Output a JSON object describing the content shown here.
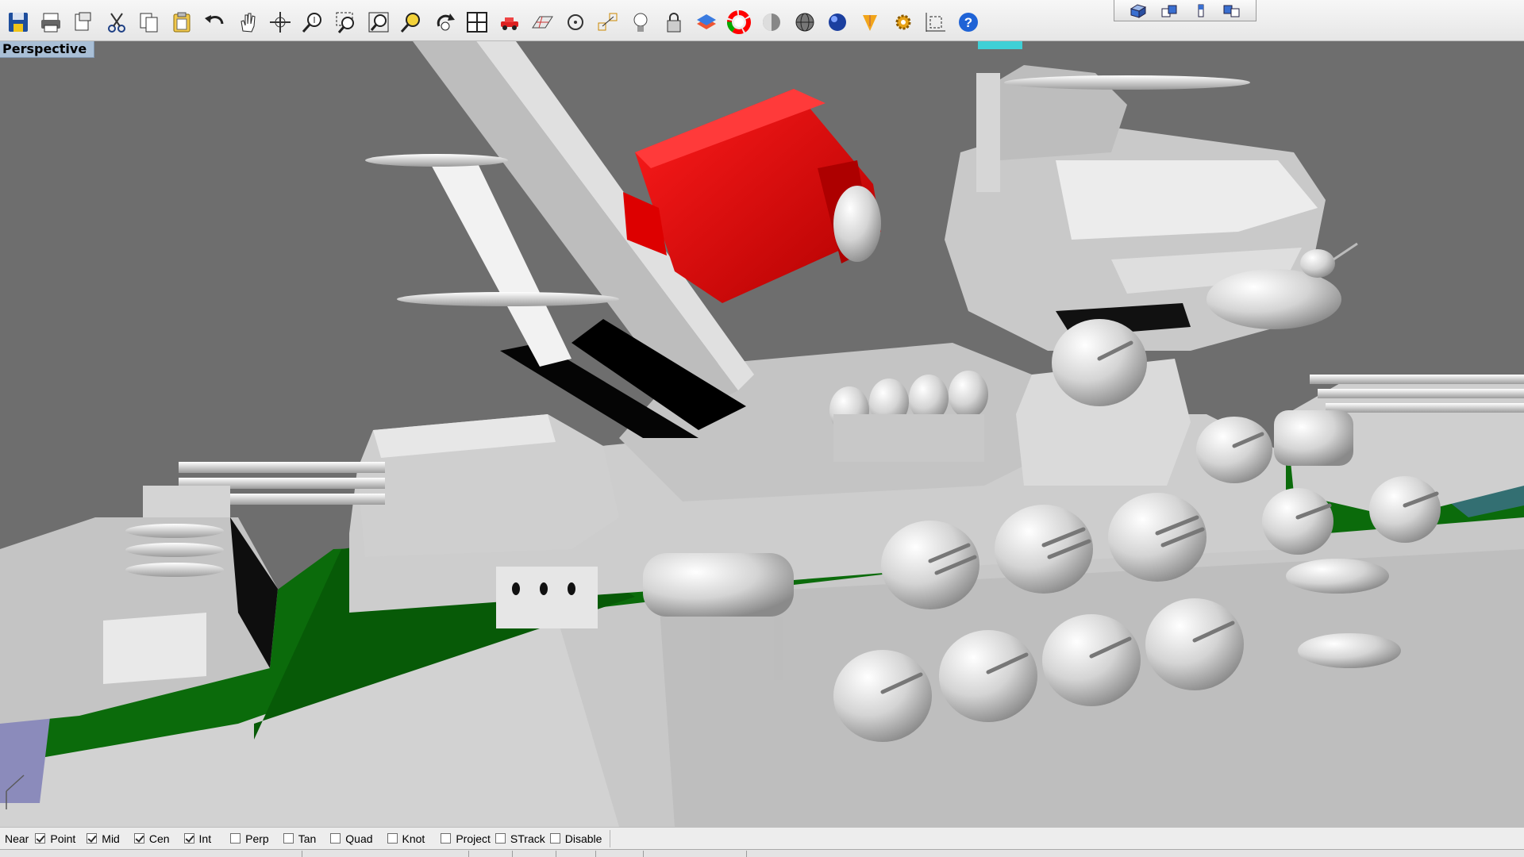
{
  "toolbar": {
    "tools": [
      {
        "name": "save-icon",
        "label": "Save"
      },
      {
        "name": "print-icon",
        "label": "Print"
      },
      {
        "name": "copy-to-layer-icon",
        "label": "Copy to clipboard"
      },
      {
        "name": "cut-icon",
        "label": "Cut"
      },
      {
        "name": "copy-icon",
        "label": "Copy"
      },
      {
        "name": "paste-icon",
        "label": "Paste"
      },
      {
        "name": "undo-icon",
        "label": "Undo"
      },
      {
        "name": "pan-hand-icon",
        "label": "Pan"
      },
      {
        "name": "rotate-view-icon",
        "label": "Rotate view"
      },
      {
        "name": "zoom-dynamic-icon",
        "label": "Zoom dynamic"
      },
      {
        "name": "zoom-window-icon",
        "label": "Zoom window"
      },
      {
        "name": "zoom-extents-icon",
        "label": "Zoom extents"
      },
      {
        "name": "zoom-selected-icon",
        "label": "Zoom selected"
      },
      {
        "name": "undo-view-icon",
        "label": "Undo view change"
      },
      {
        "name": "four-viewports-icon",
        "label": "4 viewports"
      },
      {
        "name": "car-icon",
        "label": "Select"
      },
      {
        "name": "grid-icon",
        "label": "Grid"
      },
      {
        "name": "point-icon",
        "label": "Point"
      },
      {
        "name": "osnap-icon",
        "label": "Object snap"
      },
      {
        "name": "light-bulb-icon",
        "label": "Show objects"
      },
      {
        "name": "lock-icon",
        "label": "Lock"
      },
      {
        "name": "layer-icon",
        "label": "Layers"
      },
      {
        "name": "color-wheel-icon",
        "label": "Color"
      },
      {
        "name": "shaded-sphere-icon",
        "label": "Shaded"
      },
      {
        "name": "wireframe-sphere-icon",
        "label": "Wireframe"
      },
      {
        "name": "rendered-sphere-icon",
        "label": "Rendered"
      },
      {
        "name": "render-icon",
        "label": "Render"
      },
      {
        "name": "options-gear-icon",
        "label": "Options"
      },
      {
        "name": "dimension-icon",
        "label": "Dimension"
      },
      {
        "name": "help-icon",
        "label": "Help"
      }
    ],
    "cplane_tools": [
      {
        "name": "cplane-box-icon"
      },
      {
        "name": "cplane-top-icon"
      },
      {
        "name": "cplane-front-icon"
      },
      {
        "name": "cplane-right-icon"
      }
    ]
  },
  "viewport": {
    "label": "Perspective",
    "colors": {
      "background": "#6e6e6e",
      "hull": "#cfcfcf",
      "deck": "#0a6a0a",
      "red_object": "#d80000",
      "teal_edge": "#2f6f70",
      "lilac_patch": "#8f8fc0"
    }
  },
  "osnap": {
    "items": [
      {
        "label": "Near",
        "checked": false,
        "showbox": false
      },
      {
        "label": "Point",
        "checked": true,
        "showbox": true
      },
      {
        "label": "Mid",
        "checked": true,
        "showbox": true
      },
      {
        "label": "Cen",
        "checked": true,
        "showbox": true
      },
      {
        "label": "Int",
        "checked": true,
        "showbox": true
      },
      {
        "label": "Perp",
        "checked": false,
        "showbox": true
      },
      {
        "label": "Tan",
        "checked": false,
        "showbox": true
      },
      {
        "label": "Quad",
        "checked": false,
        "showbox": true
      },
      {
        "label": "Knot",
        "checked": false,
        "showbox": true
      },
      {
        "label": "Project",
        "checked": false,
        "showbox": true
      },
      {
        "label": "STrack",
        "checked": false,
        "showbox": true
      },
      {
        "label": "Disable",
        "checked": false,
        "showbox": true
      }
    ]
  }
}
